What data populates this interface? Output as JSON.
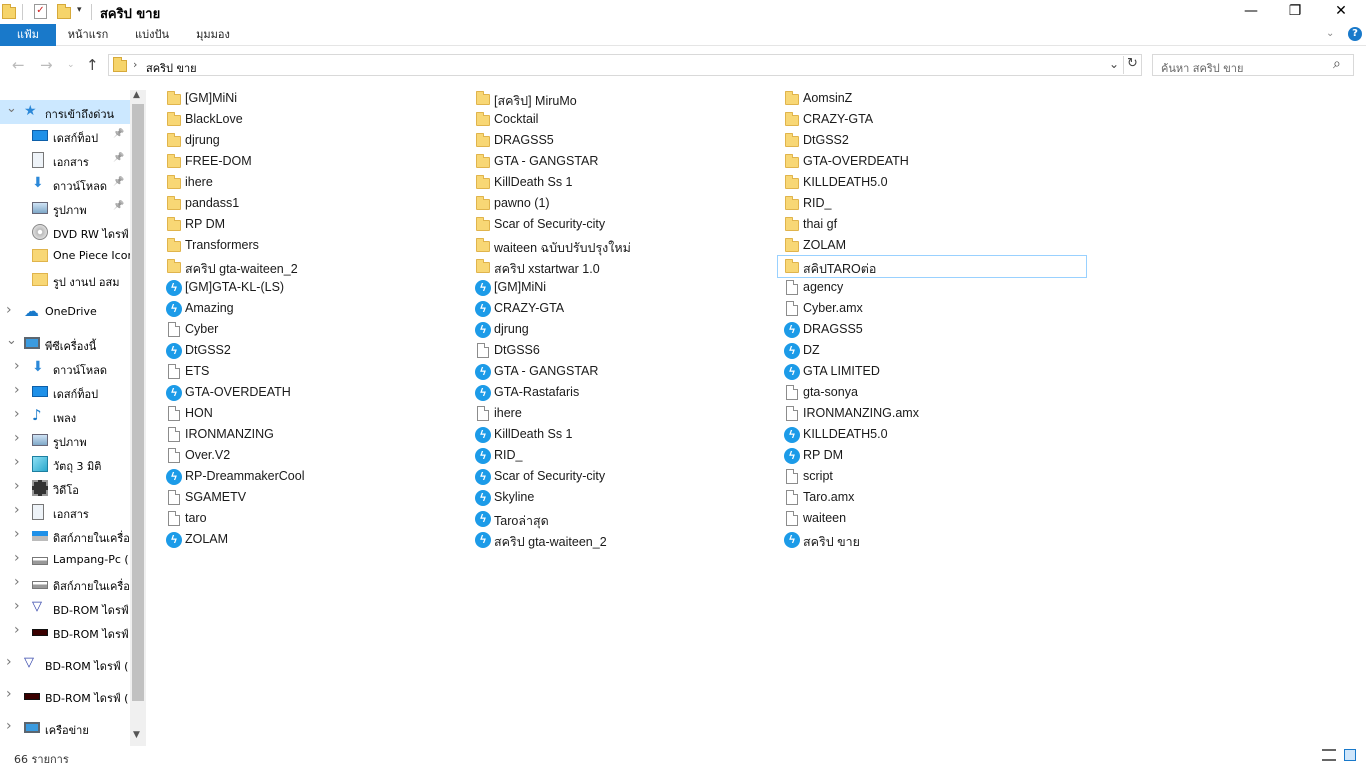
{
  "window": {
    "title": "สคริป ขาย",
    "minimize": "—",
    "maximize": "❐",
    "close": "✕"
  },
  "ribbon": {
    "tabs": [
      "แฟ้ม",
      "หน้าแรก",
      "แบ่งปัน",
      "มุมมอง"
    ],
    "help": "?"
  },
  "address": {
    "path": "สคริป ขาย",
    "search_placeholder": "ค้นหา สคริป ขาย"
  },
  "sidebar": {
    "items": [
      {
        "label": "การเข้าถึงด่วน",
        "icon": "star-icon",
        "level": 0,
        "expanded": true,
        "selected": true
      },
      {
        "label": "เดสก์ท็อป",
        "icon": "desktop-icon",
        "level": 1,
        "pinned": true
      },
      {
        "label": "เอกสาร",
        "icon": "documents-icon",
        "level": 1,
        "pinned": true
      },
      {
        "label": "ดาวน์โหลด",
        "icon": "download-icon",
        "level": 1,
        "pinned": true
      },
      {
        "label": "รูปภาพ",
        "icon": "pictures-icon",
        "level": 1,
        "pinned": true
      },
      {
        "label": "DVD RW ไดรฟ์",
        "icon": "dvd-icon",
        "level": 1
      },
      {
        "label": "One Piece Icon",
        "icon": "folder-icon",
        "level": 1
      },
      {
        "label": "รูป งานป อสม",
        "icon": "folder-icon",
        "level": 1
      },
      {
        "label": "OneDrive",
        "icon": "onedrive-icon",
        "level": 0
      },
      {
        "label": "พีซีเครื่องนี้",
        "icon": "computer-icon",
        "level": 0,
        "expanded": true
      },
      {
        "label": "ดาวน์โหลด",
        "icon": "download-icon",
        "level": 1
      },
      {
        "label": "เดสก์ท็อป",
        "icon": "desktop-icon",
        "level": 1
      },
      {
        "label": "เพลง",
        "icon": "music-icon",
        "level": 1
      },
      {
        "label": "รูปภาพ",
        "icon": "pictures-icon",
        "level": 1
      },
      {
        "label": "วัตถุ 3 มิติ",
        "icon": "3d-objects-icon",
        "level": 1
      },
      {
        "label": "วิดีโอ",
        "icon": "video-icon",
        "level": 1
      },
      {
        "label": "เอกสาร",
        "icon": "documents-icon",
        "level": 1
      },
      {
        "label": "ดิสก์ภายในเครื่อง",
        "icon": "windows-drive-icon",
        "level": 1
      },
      {
        "label": "Lampang-Pc (",
        "icon": "drive-icon",
        "level": 1
      },
      {
        "label": "ดิสก์ภายในเครื่อง",
        "icon": "drive-icon",
        "level": 1
      },
      {
        "label": "BD-ROM ไดรฟ์",
        "icon": "bdrom-icon",
        "level": 1
      },
      {
        "label": "BD-ROM ไดรฟ์",
        "icon": "bdrom-dark-icon",
        "level": 1
      },
      {
        "label": "BD-ROM ไดรฟ์ (",
        "icon": "bdrom-icon",
        "level": 0
      },
      {
        "label": "BD-ROM ไดรฟ์ (",
        "icon": "bdrom-dark-icon",
        "level": 0
      },
      {
        "label": "เครือข่าย",
        "icon": "network-icon",
        "level": 0
      }
    ]
  },
  "files": {
    "columns": [
      [
        {
          "name": "[GM]MiNi",
          "type": "folder"
        },
        {
          "name": "BlackLove",
          "type": "folder"
        },
        {
          "name": "djrung",
          "type": "folder"
        },
        {
          "name": "FREE-DOM",
          "type": "folder"
        },
        {
          "name": "ihere",
          "type": "folder"
        },
        {
          "name": "pandass1",
          "type": "folder"
        },
        {
          "name": "RP DM",
          "type": "folder"
        },
        {
          "name": "Transformers",
          "type": "folder"
        },
        {
          "name": "สคริป gta-waiteen_2",
          "type": "folder"
        },
        {
          "name": "[GM]GTA-KL-(LS)",
          "type": "app"
        },
        {
          "name": "Amazing",
          "type": "app"
        },
        {
          "name": "Cyber",
          "type": "file"
        },
        {
          "name": "DtGSS2",
          "type": "app"
        },
        {
          "name": "ETS",
          "type": "file"
        },
        {
          "name": "GTA-OVERDEATH",
          "type": "app"
        },
        {
          "name": "HON",
          "type": "file"
        },
        {
          "name": "IRONMANZING",
          "type": "file"
        },
        {
          "name": "Over.V2",
          "type": "file"
        },
        {
          "name": "RP-DreammakerCool",
          "type": "app"
        },
        {
          "name": "SGAMETV",
          "type": "file"
        },
        {
          "name": "taro",
          "type": "file"
        },
        {
          "name": "ZOLAM",
          "type": "app"
        }
      ],
      [
        {
          "name": "[สคริป] MiruMo",
          "type": "folder"
        },
        {
          "name": "Cocktail",
          "type": "folder"
        },
        {
          "name": "DRAGSS5",
          "type": "folder"
        },
        {
          "name": "GTA - GANGSTAR",
          "type": "folder"
        },
        {
          "name": "KillDeath Ss 1",
          "type": "folder"
        },
        {
          "name": "pawno (1)",
          "type": "folder"
        },
        {
          "name": "Scar of Security-city",
          "type": "folder"
        },
        {
          "name": "waiteen ฉบับปรับปรุงใหม่",
          "type": "folder"
        },
        {
          "name": "สคริป xstartwar 1.0",
          "type": "folder"
        },
        {
          "name": "[GM]MiNi",
          "type": "app"
        },
        {
          "name": "CRAZY-GTA",
          "type": "app"
        },
        {
          "name": "djrung",
          "type": "app"
        },
        {
          "name": "DtGSS6",
          "type": "file"
        },
        {
          "name": "GTA - GANGSTAR",
          "type": "app"
        },
        {
          "name": "GTA-Rastafaris",
          "type": "app"
        },
        {
          "name": "ihere",
          "type": "file"
        },
        {
          "name": "KillDeath Ss 1",
          "type": "app"
        },
        {
          "name": "RID_",
          "type": "app"
        },
        {
          "name": "Scar of Security-city",
          "type": "app"
        },
        {
          "name": "Skyline",
          "type": "app"
        },
        {
          "name": "Taroล่าสุด",
          "type": "app"
        },
        {
          "name": "สคริป gta-waiteen_2",
          "type": "app"
        }
      ],
      [
        {
          "name": "AomsinZ",
          "type": "folder"
        },
        {
          "name": "CRAZY-GTA",
          "type": "folder"
        },
        {
          "name": "DtGSS2",
          "type": "folder"
        },
        {
          "name": "GTA-OVERDEATH",
          "type": "folder"
        },
        {
          "name": "KILLDEATH5.0",
          "type": "folder"
        },
        {
          "name": "RID_",
          "type": "folder"
        },
        {
          "name": "thai gf",
          "type": "folder"
        },
        {
          "name": "ZOLAM",
          "type": "folder"
        },
        {
          "name": "สคิปTAROต่อ",
          "type": "folder",
          "selected": true
        },
        {
          "name": "agency",
          "type": "file"
        },
        {
          "name": "Cyber.amx",
          "type": "file"
        },
        {
          "name": "DRAGSS5",
          "type": "app"
        },
        {
          "name": "DZ",
          "type": "app"
        },
        {
          "name": "GTA LIMITED",
          "type": "app"
        },
        {
          "name": "gta-sonya",
          "type": "file"
        },
        {
          "name": "IRONMANZING.amx",
          "type": "file"
        },
        {
          "name": "KILLDEATH5.0",
          "type": "app"
        },
        {
          "name": "RP DM",
          "type": "app"
        },
        {
          "name": "script",
          "type": "file"
        },
        {
          "name": "Taro.amx",
          "type": "file"
        },
        {
          "name": "waiteen",
          "type": "file"
        },
        {
          "name": "สคริป ขาย",
          "type": "app"
        }
      ]
    ]
  },
  "status": {
    "count": "66 รายการ"
  }
}
